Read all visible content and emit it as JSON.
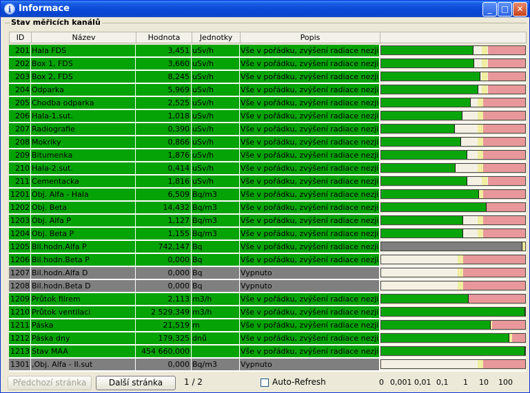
{
  "window": {
    "title": "Informace"
  },
  "group": {
    "title": "Stav měřicích kanálů"
  },
  "columns": [
    "ID",
    "Název",
    "Hodnota",
    "Jednotky",
    "Popis"
  ],
  "rows": [
    {
      "id": "201",
      "name": "Hala FDS",
      "value": "3,451",
      "unit": "uSv/h",
      "desc": "Vše v pořádku, zvýšení radiace nezjištěno",
      "state": "on",
      "level": 0.64
    },
    {
      "id": "202",
      "name": "Box 1, FDS",
      "value": "3,660",
      "unit": "uSv/h",
      "desc": "Vše v pořádku, zvýšení radiace nezjištěno",
      "state": "on",
      "level": 0.645
    },
    {
      "id": "203",
      "name": "Box 2, FDS",
      "value": "8,245",
      "unit": "uSv/h",
      "desc": "Vše v pořádku, zvýšení radiace nezjištěno",
      "state": "on",
      "level": 0.69
    },
    {
      "id": "204",
      "name": "Odparka",
      "value": "5,969",
      "unit": "uSv/h",
      "desc": "Vše v pořádku, zvýšení radiace nezjištěno",
      "state": "on",
      "level": 0.675
    },
    {
      "id": "205",
      "name": "Chodba odparka",
      "value": "2,525",
      "unit": "uSv/h",
      "desc": "Vše v pořádku, zvýšení radiace nezjištěno",
      "state": "on",
      "level": 0.62
    },
    {
      "id": "206",
      "name": "Hala-1.sut.",
      "value": "1,018",
      "unit": "uSv/h",
      "desc": "Vše v pořádku, zvýšení radiace nezjištěno",
      "state": "on",
      "level": 0.565
    },
    {
      "id": "207",
      "name": "Radiografie",
      "value": "0,390",
      "unit": "uSv/h",
      "desc": "Vše v pořádku, zvýšení radiace nezjištěno",
      "state": "on",
      "level": 0.51
    },
    {
      "id": "208",
      "name": "Mokriky",
      "value": "0,866",
      "unit": "uSv/h",
      "desc": "Vše v pořádku, zvýšení radiace nezjištěno",
      "state": "on",
      "level": 0.555
    },
    {
      "id": "209",
      "name": "Bitumenka",
      "value": "1,876",
      "unit": "uSv/h",
      "desc": "Vše v pořádku, zvýšení radiace nezjištěno",
      "state": "on",
      "level": 0.6
    },
    {
      "id": "210",
      "name": "Hala-2.sut.",
      "value": "0,414",
      "unit": "uSv/h",
      "desc": "Vše v pořádku, zvýšení radiace nezjištěno",
      "state": "on",
      "level": 0.515
    },
    {
      "id": "211",
      "name": "Cementacka",
      "value": "1,816",
      "unit": "uSv/h",
      "desc": "Vše v pořádku, zvýšení radiace nezjištěno",
      "state": "on",
      "level": 0.6
    },
    {
      "id": "1201",
      "name": "Obj. Alfa - Hala",
      "value": "6,509",
      "unit": "Bq/m3",
      "desc": "Vše v pořádku, zvýšení radiace nezjištěno",
      "state": "on",
      "level": 0.68
    },
    {
      "id": "1202",
      "name": "Obj. Beta",
      "value": "14,432",
      "unit": "Bq/m3",
      "desc": "Vše v pořádku, zvýšení radiace nezjištěno",
      "state": "on",
      "level": 0.73
    },
    {
      "id": "1203",
      "name": "Obj. Alfa P",
      "value": "1,127",
      "unit": "Bq/m3",
      "desc": "Vše v pořádku, zvýšení radiace nezjištěno",
      "state": "on",
      "level": 0.57
    },
    {
      "id": "1204",
      "name": "Obj. Beta P",
      "value": "1,155",
      "unit": "Bq/m3",
      "desc": "Vše v pořádku, zvýšení radiace nezjištěno",
      "state": "on",
      "level": 0.57
    },
    {
      "id": "1205",
      "name": "Bil.hodn.Alfa P",
      "value": "742,147",
      "unit": "Bq",
      "desc": "Vše v pořádku, zvýšení radiace nezjištěno",
      "state": "on",
      "level": 0.98,
      "bar_gray": true
    },
    {
      "id": "1206",
      "name": "Bil.hodn.Beta P",
      "value": "0,000",
      "unit": "Bq",
      "desc": "Vše v pořádku, zvýšení radiace nezjištěno",
      "state": "on",
      "level": 0
    },
    {
      "id": "1207",
      "name": "Bil.hodn.Alfa D",
      "value": "0,000",
      "unit": "Bq",
      "desc": "Vypnuto",
      "state": "off",
      "level": 0
    },
    {
      "id": "1208",
      "name": "Bil.hodn.Beta D",
      "value": "0,000",
      "unit": "Bq",
      "desc": "Vypnuto",
      "state": "off",
      "level": 0
    },
    {
      "id": "1209",
      "name": "Průtok filrem",
      "value": "2,113",
      "unit": "m3/h",
      "desc": "Vše v pořádku, zvýšení radiace nezjištěno",
      "state": "on",
      "level": 0.61
    },
    {
      "id": "1210",
      "name": "Průtok ventilaci",
      "value": "2 529,349",
      "unit": "m3/h",
      "desc": "Vše v pořádku, zvýšení radiace nezjištěno",
      "state": "on",
      "level": 1.0
    },
    {
      "id": "1211",
      "name": "Páska",
      "value": "21,519",
      "unit": "m",
      "desc": "Vše v pořádku, zvýšení radiace nezjištěno",
      "state": "on",
      "level": 0.76
    },
    {
      "id": "1212",
      "name": "Páska dny",
      "value": "179,325",
      "unit": "dnů",
      "desc": "Vše v pořádku, zvýšení radiace nezjištěno",
      "state": "on",
      "level": 0.89
    },
    {
      "id": "1213",
      "name": "Stav MAA",
      "value": "454 660,000",
      "unit": "",
      "desc": "Vše v pořádku, zvýšení radiace nezjištěno",
      "state": "on",
      "level": 1.0
    },
    {
      "id": "1301",
      "name": ",Obj. Alfa - II.sut",
      "value": "0,000",
      "unit": "Bq/m3",
      "desc": "Vypnuto",
      "state": "off",
      "level": 0
    }
  ],
  "buttons": {
    "prev": "Předchozí stránka",
    "next": "Další stránka"
  },
  "page_indicator": "1 / 2",
  "auto_refresh": {
    "label": "Auto-Refresh",
    "checked": false
  },
  "scale_labels": [
    "0",
    "0,001",
    "0,01",
    "0,1",
    "1",
    "10",
    "100"
  ],
  "colors": {
    "ok": "#05a305",
    "off": "#7f7f7f",
    "warn": "#f0eea0",
    "alarm": "#e8989a"
  }
}
